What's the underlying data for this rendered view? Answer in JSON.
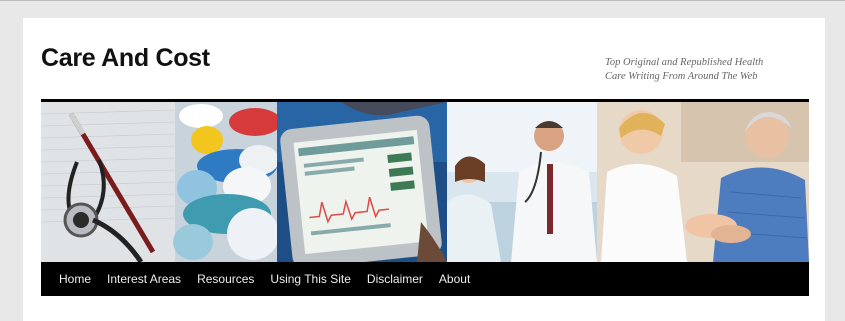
{
  "site": {
    "title": "Care And Cost",
    "tagline_line1": "Top Original and Republished Health",
    "tagline_line2": "Care Writing From Around The Web"
  },
  "nav": {
    "items": [
      {
        "label": "Home"
      },
      {
        "label": "Interest Areas"
      },
      {
        "label": "Resources"
      },
      {
        "label": "Using This Site"
      },
      {
        "label": "Disclaimer"
      },
      {
        "label": "About"
      }
    ]
  },
  "colors": {
    "page_bg": "#e8e8e8",
    "content_bg": "#ffffff",
    "nav_bg": "#000000",
    "nav_text": "#eeeeee"
  }
}
